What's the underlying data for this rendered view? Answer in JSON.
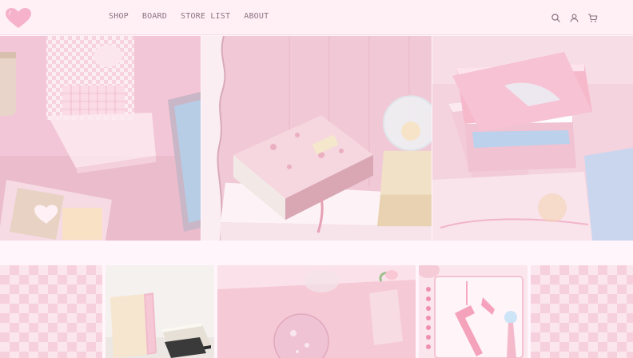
{
  "brand": {
    "logo_icon": "heart-logo-icon",
    "logo_text": "",
    "accent_color": "#f6a9c5",
    "header_bg": "#fff0f6"
  },
  "nav": {
    "items": [
      {
        "label": "SHOP"
      },
      {
        "label": "BOARD"
      },
      {
        "label": "STORE LIST"
      },
      {
        "label": "ABOUT"
      }
    ]
  },
  "header_icons": [
    "search-icon",
    "user-icon",
    "cart-icon"
  ],
  "hero": {
    "photos": [
      {
        "name": "hero-photo-calendar"
      },
      {
        "name": "hero-photo-book-snowglobe"
      },
      {
        "name": "hero-photo-memo-pads"
      }
    ]
  },
  "strip": {
    "tiles": [
      {
        "name": "pattern-tile-left"
      },
      {
        "name": "product-photo-notebooks"
      },
      {
        "name": "product-photo-crystal-ball"
      },
      {
        "name": "product-photo-binder-keys"
      },
      {
        "name": "pattern-tile-right"
      }
    ]
  }
}
